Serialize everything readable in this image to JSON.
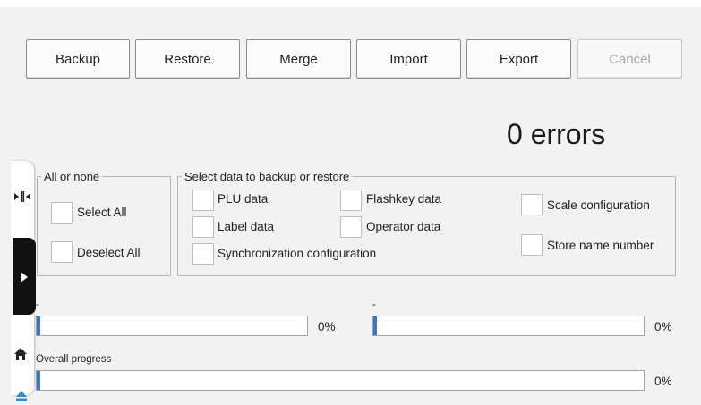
{
  "toolbar": {
    "backup": "Backup",
    "restore": "Restore",
    "merge": "Merge",
    "import": "Import",
    "export": "Export",
    "cancel": "Cancel"
  },
  "status": {
    "errors": "0 errors"
  },
  "all_or_none": {
    "legend": "All or none",
    "select_all": "Select All",
    "deselect_all": "Deselect All"
  },
  "select_data": {
    "legend": "Select data to backup or restore",
    "plu": "PLU data",
    "flashkey": "Flashkey data",
    "label": "Label data",
    "operator": "Operator data",
    "sync": "Synchronization configuration",
    "scale": "Scale configuration",
    "store": "Store name number"
  },
  "progress": {
    "left_label": "-",
    "left_pct": "0%",
    "left_value": 0,
    "right_label": "-",
    "right_pct": "0%",
    "right_value": 0,
    "overall_label": "Overall progress",
    "overall_pct": "0%",
    "overall_value": 0
  },
  "colors": {
    "progress_fill": "#3b76c7",
    "side_tab_dark": "#111111",
    "accent": "#2a8fd6"
  },
  "icons": {
    "side_top": "collapse-arrows-icon",
    "side_play": "play-icon",
    "side_home": "home-icon",
    "side_eject": "eject-icon"
  }
}
